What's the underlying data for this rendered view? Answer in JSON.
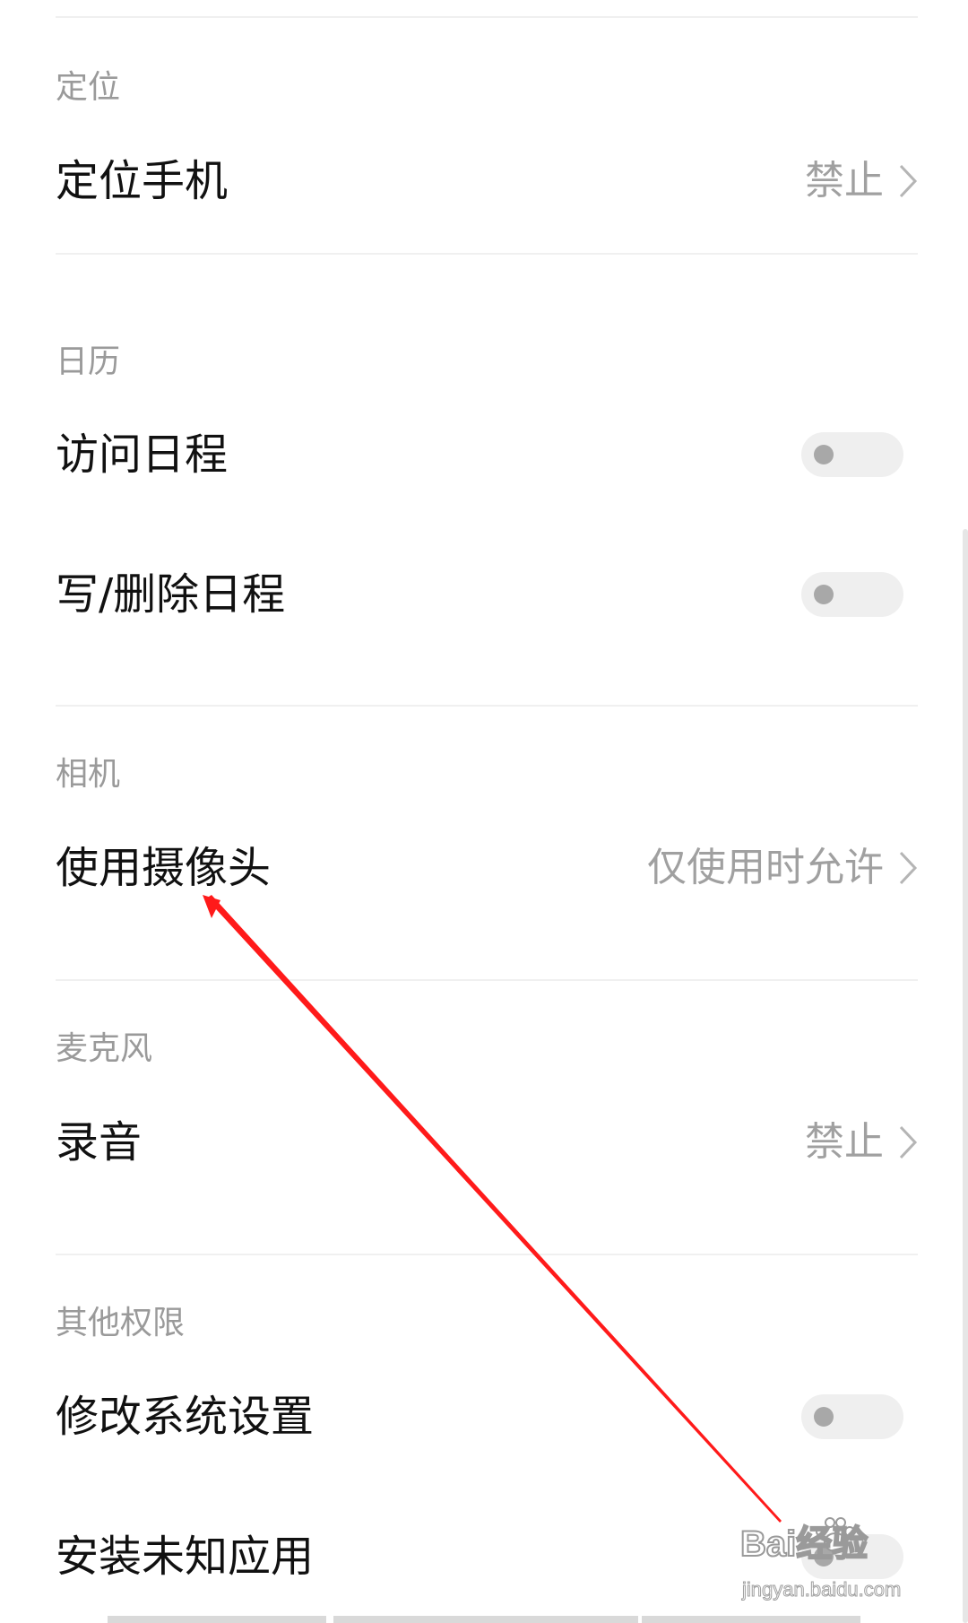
{
  "sections": [
    {
      "title": "定位",
      "rows": [
        {
          "label": "定位手机",
          "value": "禁止",
          "control": "chevron"
        }
      ]
    },
    {
      "title": "日历",
      "rows": [
        {
          "label": "访问日程",
          "control": "toggle",
          "checked": false
        },
        {
          "label": "写/删除日程",
          "control": "toggle",
          "checked": false
        }
      ]
    },
    {
      "title": "相机",
      "rows": [
        {
          "label": "使用摄像头",
          "value": "仅使用时允许",
          "control": "chevron"
        }
      ]
    },
    {
      "title": "麦克风",
      "rows": [
        {
          "label": "录音",
          "value": "禁止",
          "control": "chevron"
        }
      ]
    },
    {
      "title": "其他权限",
      "rows": [
        {
          "label": "修改系统设置",
          "control": "toggle",
          "checked": false
        },
        {
          "label": "安装未知应用",
          "control": "toggle",
          "checked": false
        }
      ]
    }
  ],
  "watermark": {
    "brand": "Bai经验",
    "url": "jingyan.baidu.com"
  },
  "colors": {
    "annotation_arrow": "#ff1a1a",
    "section_title": "#9a9a9a",
    "value_text": "#a0a0a0",
    "toggle_track": "#efefef",
    "toggle_knob": "#a8a8a8"
  }
}
